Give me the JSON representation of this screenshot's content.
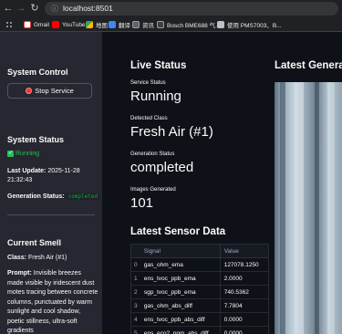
{
  "browser": {
    "url": "localhost:8501",
    "bookmarks": [
      {
        "label": "",
        "icon": "grid-icon",
        "color": "#9aa0a6"
      },
      {
        "label": "Gmail",
        "icon": "gmail-icon",
        "color": "#ea4335"
      },
      {
        "label": "YouTube",
        "icon": "youtube-icon",
        "color": "#ff0000"
      },
      {
        "label": "地图",
        "icon": "maps-icon",
        "color": "#34a853"
      },
      {
        "label": "翻译",
        "icon": "translate-icon",
        "color": "#4285f4"
      },
      {
        "label": "资讯",
        "icon": "news-icon",
        "color": "#5f6368"
      },
      {
        "label": "Bosch BME688 气...",
        "icon": "bosch-icon",
        "color": "#9aa0a6"
      },
      {
        "label": "使用 PMS7003、B...",
        "icon": "page-icon",
        "color": "#bdc1c6"
      }
    ]
  },
  "sidebar": {
    "system_control_title": "System Control",
    "stop_button": "Stop Service",
    "system_status_title": "System Status",
    "status_text": "Running",
    "last_update_label": "Last Update:",
    "last_update_value": "2025-11-28 21:32:43",
    "generation_status_label": "Generation Status:",
    "generation_status_value": "completed",
    "current_smell_title": "Current Smell",
    "class_label": "Class:",
    "class_value": "Fresh Air (#1)",
    "prompt_label": "Prompt:",
    "prompt_value": "Invisible breezes made visible by iridescent dust motes tracing between concrete columns, punctuated by warm sunlight and cool shadow, poetic stillness, ultra-soft gradients"
  },
  "main": {
    "live_status_title": "Live Status",
    "service_status_label": "Service Status",
    "service_status_value": "Running",
    "detected_class_label": "Detected Class",
    "detected_class_value": "Fresh Air (#1)",
    "generation_status_label": "Generation Status",
    "generation_status_value": "completed",
    "images_generated_label": "Images Generated",
    "images_generated_value": "101",
    "latest_generated_title": "Latest Generate",
    "sensor_title": "Latest Sensor Data",
    "table": {
      "columns": [
        "",
        "Signal",
        "Value"
      ],
      "rows": [
        {
          "idx": "0",
          "signal": "gas_ohm_ema",
          "value": "127078.1250"
        },
        {
          "idx": "1",
          "signal": "ens_tvoc_ppb_ema",
          "value": "2.0000"
        },
        {
          "idx": "2",
          "signal": "sgp_tvoc_ppb_ema",
          "value": "740.5362"
        },
        {
          "idx": "3",
          "signal": "gas_ohm_abs_diff",
          "value": "7.7804"
        },
        {
          "idx": "4",
          "signal": "ens_tvoc_ppb_abs_diff",
          "value": "0.0000"
        },
        {
          "idx": "5",
          "signal": "ens_eco2_ppm_abs_diff",
          "value": "0.0000"
        }
      ]
    }
  }
}
